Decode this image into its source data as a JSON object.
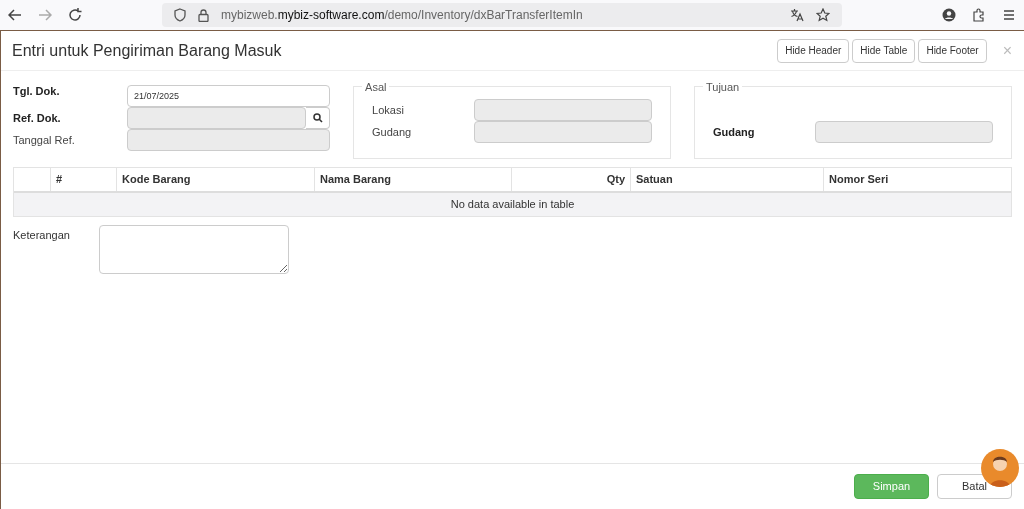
{
  "browser": {
    "url_host": "mybizweb.",
    "url_domain": "mybiz-software.com",
    "url_path": "/demo/Inventory/dxBarTransferItemIn"
  },
  "modal": {
    "title": "Entri untuk Pengiriman Barang Masuk",
    "header_buttons": [
      "Hide Header",
      "Hide Table",
      "Hide Footer"
    ],
    "close": "×"
  },
  "form": {
    "fields": [
      {
        "label": "Tgl. Dok.",
        "bold": true,
        "value": "21/07/2025",
        "disabled": false,
        "search": false
      },
      {
        "label": "Ref. Dok.",
        "bold": true,
        "disabled": true,
        "search": true
      },
      {
        "label": "Tanggal Ref.",
        "bold": false,
        "disabled": true,
        "search": false
      }
    ],
    "asal": {
      "legend": "Asal",
      "fields": [
        {
          "label": "Lokasi",
          "bold": false
        },
        {
          "label": "Gudang",
          "bold": false
        }
      ]
    },
    "tujuan": {
      "legend": "Tujuan",
      "fields": [
        {
          "label": "Gudang",
          "bold": true
        }
      ]
    }
  },
  "table": {
    "columns": [
      {
        "kind": "text"
      },
      {
        "label": "#",
        "kind": "text"
      },
      {
        "label": "Kode Barang",
        "kind": "text"
      },
      {
        "label": "Nama Barang",
        "kind": "text"
      },
      {
        "label": "Qty",
        "kind": "number"
      },
      {
        "label": "Satuan",
        "kind": "text"
      },
      {
        "label": "Nomor Seri",
        "kind": "text"
      }
    ],
    "empty_message": "No data available in table"
  },
  "notes": {
    "label": "Keterangan"
  },
  "footer": {
    "buttons": [
      {
        "label": "Simpan",
        "kind": "primary"
      },
      {
        "label": "Batal",
        "kind": "default"
      }
    ]
  }
}
